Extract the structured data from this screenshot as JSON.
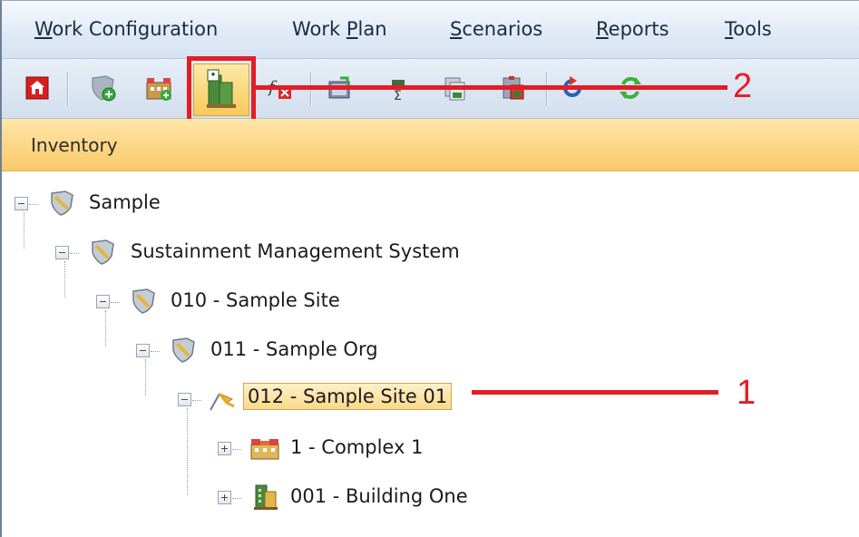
{
  "menu": {
    "items": [
      {
        "pre": "",
        "ul": "W",
        "post": "ork Configuration"
      },
      {
        "pre": "Work ",
        "ul": "P",
        "post": "lan"
      },
      {
        "pre": "",
        "ul": "S",
        "post": "cenarios"
      },
      {
        "pre": "",
        "ul": "R",
        "post": "eports"
      },
      {
        "pre": "",
        "ul": "T",
        "post": "ools"
      }
    ]
  },
  "toolbar": {
    "icons": [
      "home-icon",
      "add-site-shield-icon",
      "add-complex-icon",
      "add-building-icon",
      "delete-formula-icon",
      "edit-icon",
      "sum-icon",
      "copy-icon",
      "paste-icon",
      "undo-icon",
      "refresh-icon"
    ]
  },
  "panel": {
    "title": "Inventory"
  },
  "tree": {
    "nodes": [
      {
        "label": "Sample",
        "icon": "shield-icon"
      },
      {
        "label": "Sustainment Management System",
        "icon": "shield-icon"
      },
      {
        "label": "010 - Sample Site",
        "icon": "shield-icon"
      },
      {
        "label": "011 - Sample Org",
        "icon": "shield-icon"
      },
      {
        "label": "012 - Sample Site 01",
        "icon": "site-flag-icon",
        "selected": true
      },
      {
        "label": "1 - Complex 1",
        "icon": "complex-icon"
      },
      {
        "label": "001 - Building One",
        "icon": "building-icon"
      }
    ]
  },
  "annotations": {
    "callout_1": "1",
    "callout_2": "2",
    "color": "#e31d25"
  }
}
